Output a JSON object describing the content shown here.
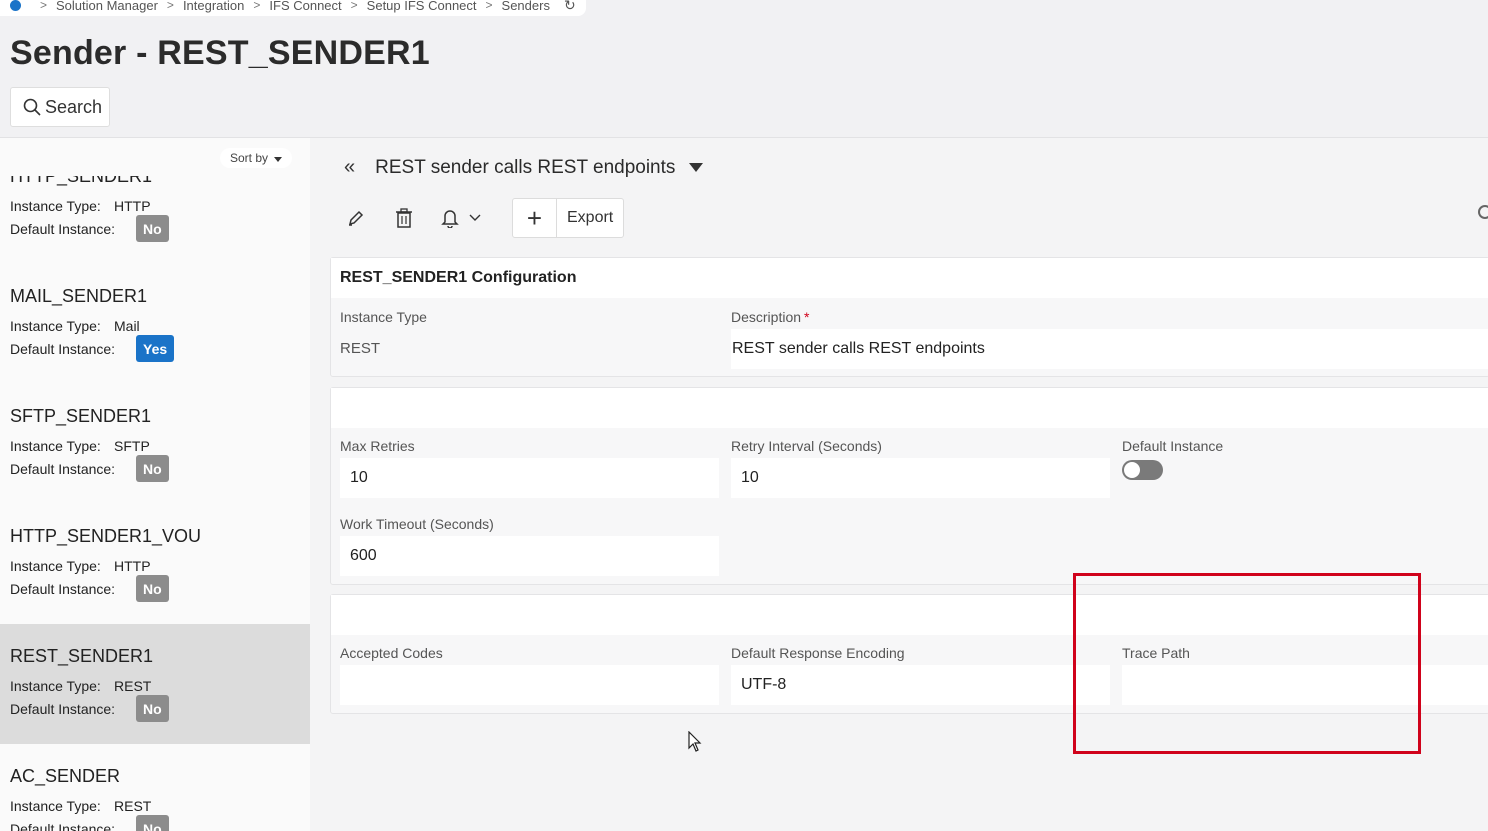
{
  "breadcrumb": {
    "items": [
      "Solution Manager",
      "Integration",
      "IFS Connect",
      "Setup IFS Connect",
      "Senders"
    ]
  },
  "page": {
    "title": "Sender - REST_SENDER1",
    "search_label": "Search"
  },
  "list": {
    "sort_label": "Sort by",
    "type_label": "Instance Type:",
    "default_label": "Default Instance:",
    "partial_top": {
      "name": "HTTP_SENDER1",
      "type": "HTTP",
      "default": "No"
    },
    "items": [
      {
        "name": "MAIL_SENDER1",
        "type": "Mail",
        "default": "Yes"
      },
      {
        "name": "SFTP_SENDER1",
        "type": "SFTP",
        "default": "No"
      },
      {
        "name": "HTTP_SENDER1_VOU",
        "type": "HTTP",
        "default": "No"
      },
      {
        "name": "REST_SENDER1",
        "type": "REST",
        "default": "No"
      },
      {
        "name": "AC_SENDER",
        "type": "REST",
        "default": "No"
      }
    ]
  },
  "detail": {
    "header": "REST sender calls REST endpoints",
    "toolbar": {
      "export_label": "Export"
    },
    "config_card": {
      "title": "REST_SENDER1 Configuration",
      "instance_type_label": "Instance Type",
      "instance_type_value": "REST",
      "description_label": "Description",
      "description_required": "*",
      "description_value": "REST sender calls REST endpoints"
    },
    "retry_card": {
      "max_retries_label": "Max Retries",
      "max_retries_value": "10",
      "retry_interval_label": "Retry Interval (Seconds)",
      "retry_interval_value": "10",
      "default_instance_label": "Default Instance",
      "default_instance_on": false,
      "work_timeout_label": "Work Timeout (Seconds)",
      "work_timeout_value": "600"
    },
    "codes_card": {
      "accepted_codes_label": "Accepted Codes",
      "accepted_codes_value": "",
      "encoding_label": "Default Response Encoding",
      "encoding_value": "UTF-8",
      "trace_path_label": "Trace Path",
      "trace_path_value": ""
    }
  },
  "colors": {
    "accent": "#1a73c8",
    "highlight": "#d0021b",
    "badge_no": "#8c8c8c"
  }
}
